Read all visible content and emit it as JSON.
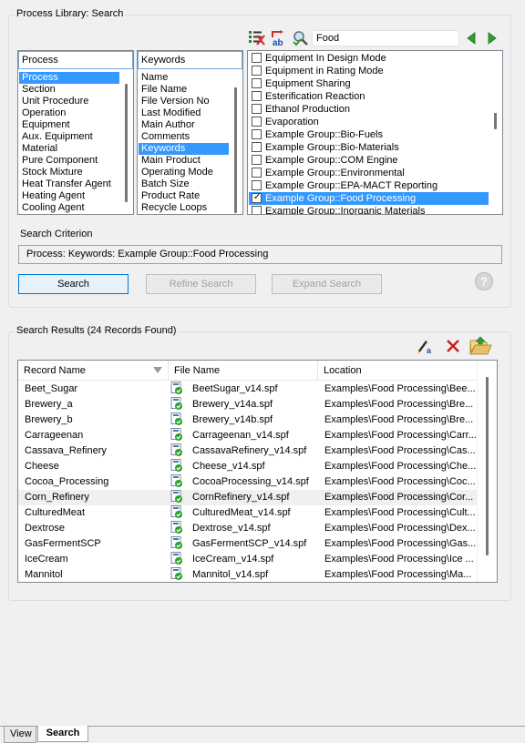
{
  "library": {
    "title": "Process Library: Search",
    "search_value": "Food",
    "process_list": {
      "header": "Process",
      "items": [
        "Process",
        "Section",
        "Unit Procedure",
        "Operation",
        "Equipment",
        "Aux. Equipment",
        "Material",
        "Pure Component",
        "Stock Mixture",
        "Heat Transfer Agent",
        "Heating Agent",
        "Cooling Agent"
      ],
      "selected_index": 0
    },
    "keywords_list": {
      "header": "Keywords",
      "items": [
        "Name",
        "File Name",
        "File Version No",
        "Last Modified",
        "Main Author",
        "Comments",
        "Keywords",
        "Main Product",
        "Operating Mode",
        "Batch Size",
        "Product Rate",
        "Recycle Loops"
      ],
      "selected_index": 6
    },
    "values_list": {
      "items": [
        {
          "label": "Equipment In Design Mode",
          "checked": false
        },
        {
          "label": "Equipment in Rating Mode",
          "checked": false
        },
        {
          "label": "Equipment Sharing",
          "checked": false
        },
        {
          "label": "Esterification Reaction",
          "checked": false
        },
        {
          "label": "Ethanol Production",
          "checked": false
        },
        {
          "label": "Evaporation",
          "checked": false
        },
        {
          "label": "Example Group::Bio-Fuels",
          "checked": false
        },
        {
          "label": "Example Group::Bio-Materials",
          "checked": false
        },
        {
          "label": "Example Group::COM Engine",
          "checked": false
        },
        {
          "label": "Example Group::Environmental",
          "checked": false
        },
        {
          "label": "Example Group::EPA-MACT Reporting",
          "checked": false
        },
        {
          "label": "Example Group::Food Processing",
          "checked": true
        },
        {
          "label": "Example Group::Inorganic Materials",
          "checked": false
        }
      ],
      "selected_index": 11
    },
    "criterion_label": "Search Criterion",
    "criterion_value": "Process: Keywords: Example Group::Food Processing",
    "buttons": {
      "search": "Search",
      "refine": "Refine Search",
      "expand": "Expand Search"
    }
  },
  "results": {
    "title": "Search Results (24 Records Found)",
    "columns": [
      "Record Name",
      "File Name",
      "Location"
    ],
    "highlighted_index": 7,
    "rows": [
      {
        "name": "Beet_Sugar",
        "file": "BeetSugar_v14.spf",
        "location": "Examples\\Food Processing\\Bee..."
      },
      {
        "name": "Brewery_a",
        "file": "Brewery_v14a.spf",
        "location": "Examples\\Food Processing\\Bre..."
      },
      {
        "name": "Brewery_b",
        "file": "Brewery_v14b.spf",
        "location": "Examples\\Food Processing\\Bre..."
      },
      {
        "name": "Carrageenan",
        "file": "Carrageenan_v14.spf",
        "location": "Examples\\Food Processing\\Carr..."
      },
      {
        "name": "Cassava_Refinery",
        "file": "CassavaRefinery_v14.spf",
        "location": "Examples\\Food Processing\\Cas..."
      },
      {
        "name": "Cheese",
        "file": "Cheese_v14.spf",
        "location": "Examples\\Food Processing\\Che..."
      },
      {
        "name": "Cocoa_Processing",
        "file": "CocoaProcessing_v14.spf",
        "location": "Examples\\Food Processing\\Coc..."
      },
      {
        "name": "Corn_Refinery",
        "file": "CornRefinery_v14.spf",
        "location": "Examples\\Food Processing\\Cor..."
      },
      {
        "name": "CulturedMeat",
        "file": "CulturedMeat_v14.spf",
        "location": "Examples\\Food Processing\\Cult..."
      },
      {
        "name": "Dextrose",
        "file": "Dextrose_v14.spf",
        "location": "Examples\\Food Processing\\Dex..."
      },
      {
        "name": "GasFermentSCP",
        "file": "GasFermentSCP_v14.spf",
        "location": "Examples\\Food Processing\\Gas..."
      },
      {
        "name": "IceCream",
        "file": "IceCream_v14.spf",
        "location": "Examples\\Food Processing\\Ice ..."
      },
      {
        "name": "Mannitol",
        "file": "Mannitol_v14.spf",
        "location": "Examples\\Food Processing\\Ma..."
      }
    ]
  },
  "tabs": [
    "View",
    "Search"
  ],
  "active_tab": "Search",
  "icons": {
    "clear_check": "clear-checks-icon",
    "find_replace": "ab-icon",
    "search": "search-check-icon",
    "prev": "prev-arrow-icon",
    "next": "next-arrow-icon",
    "help": "help-icon",
    "edit": "edit-icon",
    "delete": "delete-icon",
    "open_folder": "open-folder-icon"
  },
  "colors": {
    "selection": "#3399ff",
    "arrow_green": "#2e9e2e",
    "delete_red": "#cc1a1a"
  }
}
